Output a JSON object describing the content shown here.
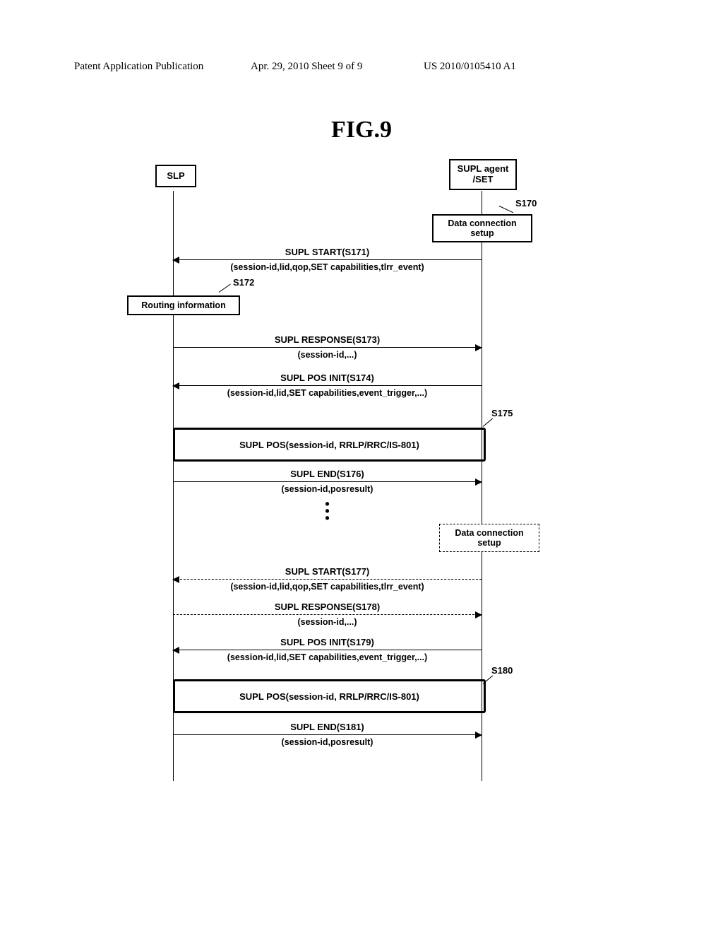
{
  "header": {
    "left": "Patent Application Publication",
    "center": "Apr. 29, 2010  Sheet 9 of 9",
    "right": "US 2010/0105410 A1"
  },
  "figure_title": "FIG.9",
  "actors": {
    "slp": "SLP",
    "set": "SUPL agent\n/SET"
  },
  "side_labels": {
    "s170": "S170",
    "s172": "S172",
    "s175": "S175",
    "s180": "S180"
  },
  "boxes": {
    "data_conn_1": "Data connection\nsetup",
    "routing": "Routing information",
    "data_conn_2": "Data connection\nsetup"
  },
  "pos_blocks": {
    "p1": "SUPL POS(session-id, RRLP/RRC/IS-801)",
    "p2": "SUPL POS(session-id, RRLP/RRC/IS-801)"
  },
  "dots": "•\n•\n•",
  "messages": {
    "m171_t": "SUPL START(S171)",
    "m171_s": "(session-id,lid,qop,SET capabilities,tlrr_event)",
    "m173_t": "SUPL RESPONSE(S173)",
    "m173_s": "(session-id,...)",
    "m174_t": "SUPL POS INIT(S174)",
    "m174_s": "(session-id,lid,SET capabilities,event_trigger,...)",
    "m176_t": "SUPL END(S176)",
    "m176_s": "(session-id,posresult)",
    "m177_t": "SUPL START(S177)",
    "m177_s": "(session-id,lid,qop,SET capabilities,tlrr_event)",
    "m178_t": "SUPL RESPONSE(S178)",
    "m178_s": "(session-id,...)",
    "m179_t": "SUPL POS INIT(S179)",
    "m179_s": "(session-id,lid,SET capabilities,event_trigger,...)",
    "m181_t": "SUPL END(S181)",
    "m181_s": "(session-id,posresult)"
  }
}
